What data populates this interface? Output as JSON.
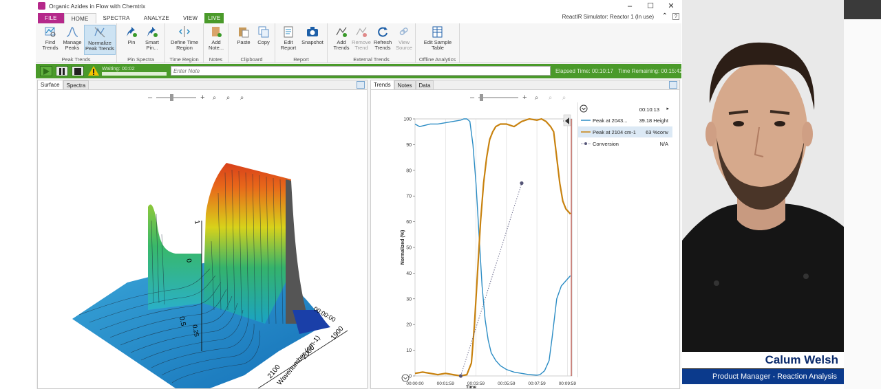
{
  "window": {
    "title": "Organic Azides in Flow with Chemtrix",
    "simulator_status": "ReactIR Simulator: Reactor 1 (In use)"
  },
  "ribbon_tabs": [
    {
      "label": "FILE"
    },
    {
      "label": "HOME"
    },
    {
      "label": "SPECTRA"
    },
    {
      "label": "ANALYZE"
    },
    {
      "label": "VIEW"
    },
    {
      "label": "LIVE"
    }
  ],
  "ribbon": {
    "find_trends": "Find Trends",
    "manage_peaks": "Manage Peaks",
    "normalize_peak_trends": "Normalize Peak Trends",
    "peak_trends_group": "Peak Trends",
    "pin": "Pin",
    "smart_pin": "Smart Pin...",
    "pin_spectra_group": "Pin Spectra",
    "define_time_region": "Define Time Region",
    "time_region_group": "Time Region",
    "add_note": "Add Note...",
    "notes_group": "Notes",
    "paste": "Paste",
    "copy": "Copy",
    "clipboard_group": "Clipboard",
    "edit_report": "Edit Report",
    "snapshot": "Snapshot",
    "report_group": "Report",
    "add_trends": "Add Trends",
    "remove_trend": "Remove Trend",
    "refresh_trends": "Refresh Trends",
    "view_source": "View Source",
    "external_trends_group": "External Trends",
    "edit_sample_table": "Edit Sample Table",
    "offline_analytics_group": "Offline Analytics"
  },
  "runbar": {
    "waiting": "Waiting: 00:02",
    "note_placeholder": "Enter Note",
    "elapsed": "Elapsed Time: 00:10:17",
    "remaining": "Time Remaining: 00:15:42"
  },
  "left_panel": {
    "tabs": [
      {
        "label": "Surface"
      },
      {
        "label": "Spectra"
      }
    ]
  },
  "right_panel": {
    "tabs": [
      {
        "label": "Trends"
      },
      {
        "label": "Notes"
      },
      {
        "label": "Data"
      }
    ],
    "legend_time": "00:10:13",
    "legend": [
      {
        "name": "Peak at 2043...",
        "value": "39.18 Height",
        "color": "#2b8cc4"
      },
      {
        "name": "Peak at 2104 cm-1",
        "value": "63 %conv",
        "color": "#c8820f"
      },
      {
        "name": "Conversion",
        "value": "N/A",
        "color": "#666688"
      }
    ]
  },
  "surface_labels": {
    "wavenumber_axis": "Wavenumber (cm-1)",
    "ticks": [
      "2100",
      "2000",
      "1900"
    ],
    "time_tick": "00:00:00",
    "z_ticks": [
      "0",
      "0.5",
      "1"
    ],
    "small_label": "0.25"
  },
  "chart_data": {
    "type": "line",
    "xlabel": "Time",
    "ylabel": "Normalized (%)",
    "ylim": [
      0,
      100
    ],
    "yticks": [
      0,
      10,
      20,
      30,
      40,
      50,
      60,
      70,
      80,
      90,
      100
    ],
    "xticks": [
      "00:00:00",
      "00:01:59",
      "00:03:59",
      "00:05:59",
      "00:07:59",
      "00:09:59"
    ],
    "xlim_minutes": [
      0,
      10.3
    ],
    "series": [
      {
        "name": "Peak at 2043...",
        "color": "#2b8cc4",
        "x": [
          0,
          0.3,
          1.0,
          1.5,
          2.0,
          2.5,
          3.0,
          3.2,
          3.4,
          3.6,
          3.8,
          4.0,
          4.2,
          4.4,
          4.6,
          4.8,
          5.0,
          5.3,
          5.6,
          6.0,
          6.5,
          7.0,
          7.5,
          8.0,
          8.2,
          8.5,
          8.8,
          9.0,
          9.3,
          9.6,
          9.9,
          10.2
        ],
        "y": [
          98,
          97,
          98,
          98,
          98.5,
          99,
          99.5,
          100,
          100,
          99,
          90,
          75,
          55,
          35,
          22,
          14,
          9,
          6,
          4,
          2.5,
          1.5,
          1,
          0.5,
          0.3,
          0.5,
          2,
          6,
          15,
          30,
          35,
          37,
          39
        ]
      },
      {
        "name": "Peak at 2104 cm-1",
        "color": "#c8820f",
        "x": [
          0,
          0.5,
          1.0,
          1.5,
          2.0,
          2.5,
          3.0,
          3.4,
          3.7,
          3.9,
          4.1,
          4.3,
          4.5,
          4.7,
          4.9,
          5.1,
          5.3,
          5.6,
          6.0,
          6.5,
          7.0,
          7.5,
          8.0,
          8.3,
          8.6,
          8.9,
          9.1,
          9.3,
          9.5,
          9.7,
          9.9,
          10.2
        ],
        "y": [
          1,
          1.5,
          1,
          0.5,
          1,
          0.5,
          0,
          0.5,
          5,
          20,
          40,
          60,
          75,
          85,
          92,
          95,
          97,
          98,
          98,
          97,
          99,
          100,
          99.5,
          100,
          99,
          97,
          95,
          85,
          75,
          68,
          65,
          63
        ]
      },
      {
        "name": "Conversion",
        "color": "#666688",
        "style": "dotted",
        "x": [
          3.0,
          7.0
        ],
        "y": [
          0,
          75
        ]
      }
    ]
  }
}
